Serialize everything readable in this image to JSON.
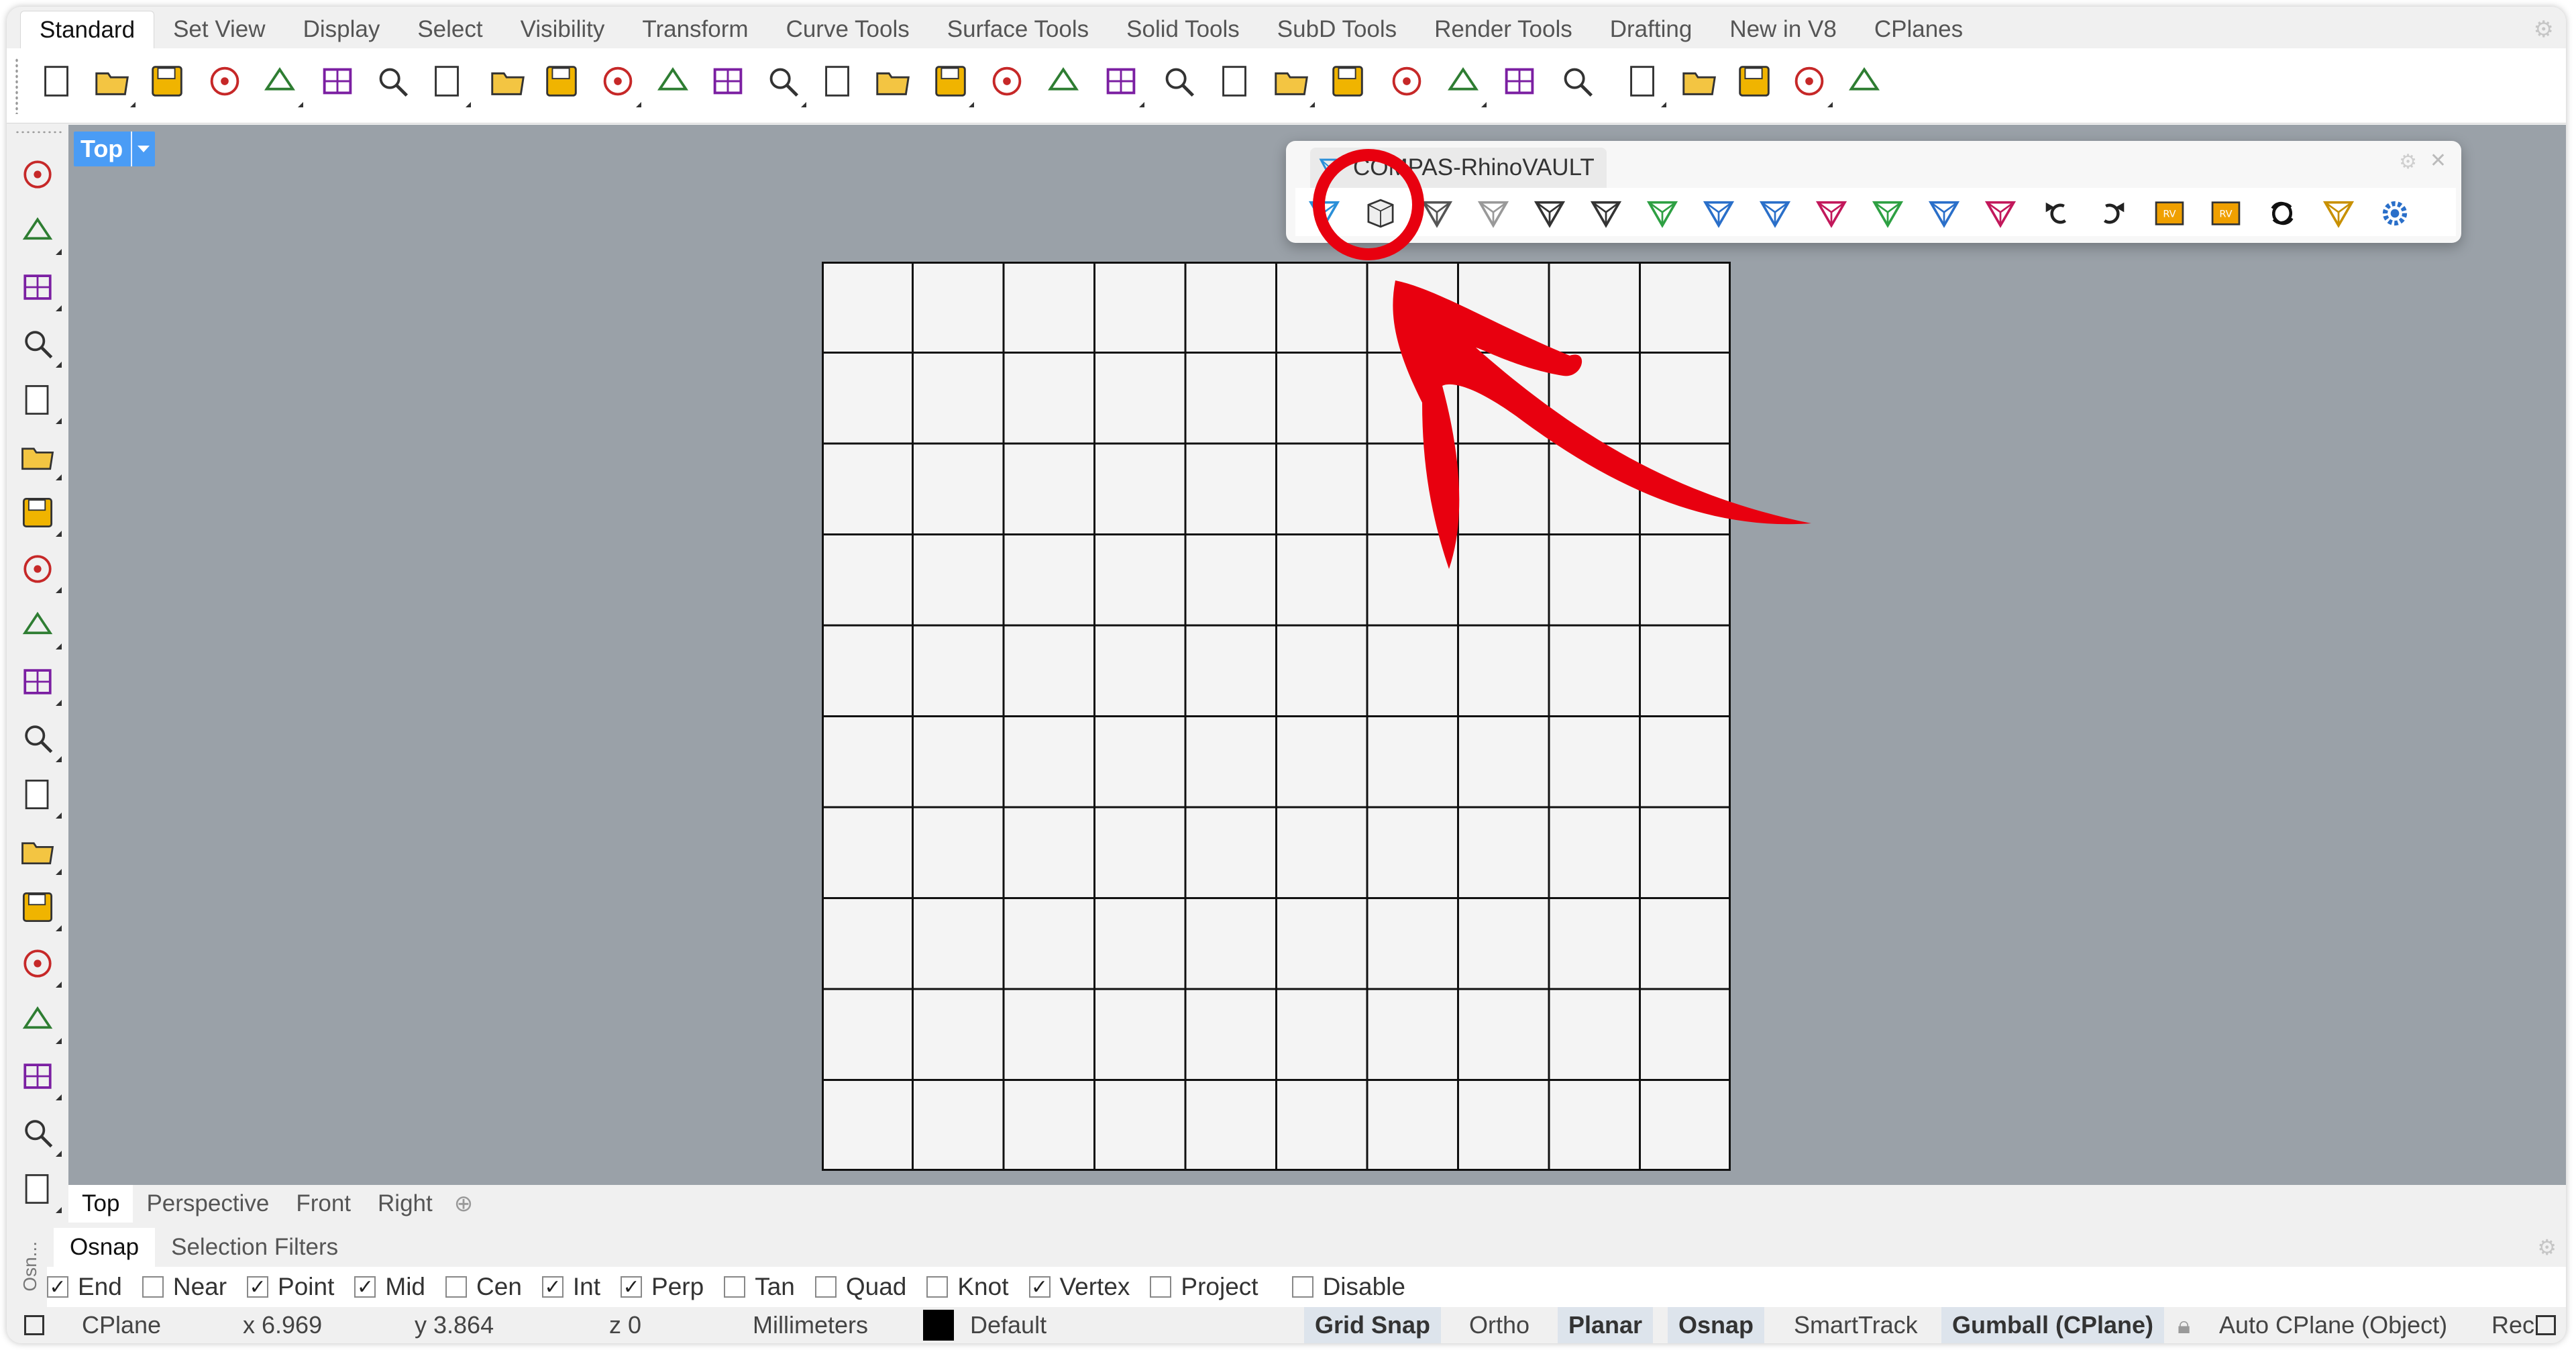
{
  "menu_tabs": [
    "Standard",
    "Set View",
    "Display",
    "Select",
    "Visibility",
    "Transform",
    "Curve Tools",
    "Surface Tools",
    "Solid Tools",
    "SubD Tools",
    "Render Tools",
    "Drafting",
    "New in V8",
    "CPlanes"
  ],
  "active_menu_tab": "Standard",
  "toolbar_icons": [
    "new-file-icon",
    "open-file-icon",
    "save-icon",
    "print-icon",
    "export-icon",
    "cut-icon",
    "copy-icon",
    "paste-icon",
    "undo-icon",
    "pan-hand-icon",
    "rotate-view-icon",
    "zoom-dynamic-icon",
    "zoom-window-icon",
    "zoom-extents-icon",
    "zoom-selected-icon",
    "undo-view-icon",
    "four-viewports-icon",
    "car-icon",
    "cplane-icon",
    "circle-point-icon",
    "properties-icon",
    "light-icon",
    "lock-icon",
    "layer-icon",
    "color-wheel-icon",
    "shaded-sphere-icon",
    "wireframe-sphere-icon",
    "render-sphere-icon",
    "spotlight-icon",
    "options-gear-icon",
    "tree-icon",
    "globe-icon",
    "help-icon"
  ],
  "left_toolbar_icons": [
    "select-arrow-icon",
    "point-icon",
    "polyline-icon",
    "curve-icon",
    "circle-icon",
    "ellipse-icon",
    "arc-icon",
    "rectangle-icon",
    "polygon-icon",
    "fillet-icon",
    "surface-icon",
    "extrude-icon",
    "box-icon",
    "boolean-icon",
    "cylinder-icon",
    "mesh-icon",
    "transform-gear-icon",
    "explode-icon",
    "dimension-icon"
  ],
  "viewport": {
    "name": "Top",
    "background": "#9aa1a8",
    "grid_rows": 10,
    "grid_cols": 10
  },
  "plugin_panel": {
    "title": "COMPAS-RhinoVAULT",
    "icons": [
      "rv-init-icon",
      "form-diagram-icon",
      "form-mesh-icon",
      "form-sphere-icon",
      "form-modify-icon",
      "form-boundary-icon",
      "thrust-diagram-icon",
      "dome-icon",
      "force-diagram-icon",
      "equilibrium-icon",
      "thrust-modify-icon",
      "force-modify-icon",
      "thrust-network-icon",
      "undo-icon",
      "redo-icon",
      "open-rv-icon",
      "save-rv-icon",
      "refresh-icon",
      "clear-icon",
      "settings-icon"
    ]
  },
  "annotation": {
    "target": "form-diagram-icon",
    "color": "#e8000f"
  },
  "view_tabs": [
    "Top",
    "Perspective",
    "Front",
    "Right"
  ],
  "active_view_tab": "Top",
  "osnap_grip_label": "Osn...",
  "panel_tabs": [
    "Osnap",
    "Selection Filters"
  ],
  "osnaps": [
    {
      "label": "End",
      "checked": true
    },
    {
      "label": "Near",
      "checked": false
    },
    {
      "label": "Point",
      "checked": true
    },
    {
      "label": "Mid",
      "checked": true
    },
    {
      "label": "Cen",
      "checked": false
    },
    {
      "label": "Int",
      "checked": true
    },
    {
      "label": "Perp",
      "checked": true
    },
    {
      "label": "Tan",
      "checked": false
    },
    {
      "label": "Quad",
      "checked": false
    },
    {
      "label": "Knot",
      "checked": false
    },
    {
      "label": "Vertex",
      "checked": true
    },
    {
      "label": "Project",
      "checked": false
    },
    {
      "label": "Disable",
      "checked": false
    }
  ],
  "status": {
    "cplane": "CPlane",
    "x": "x 6.969",
    "y": "y 3.864",
    "z": "z 0",
    "units": "Millimeters",
    "layer": "Default",
    "grid_snap": "Grid Snap",
    "ortho": "Ortho",
    "planar": "Planar",
    "osnap": "Osnap",
    "smarttrack": "SmartTrack",
    "gumball": "Gumball (CPlane)",
    "auto_cplane": "Auto CPlane (Object)",
    "record": "Rec"
  }
}
